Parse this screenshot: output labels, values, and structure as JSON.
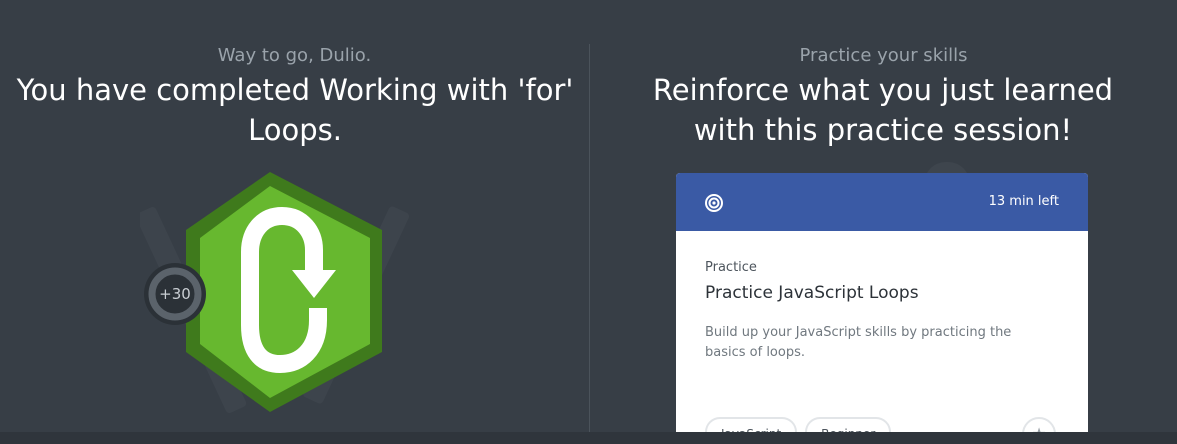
{
  "completion": {
    "eyebrow": "Way to go, Dulio.",
    "heading": "You have completed Working with 'for' Loops.",
    "xp": "+30",
    "badge_icon": "loop-arrow-icon"
  },
  "practice": {
    "eyebrow": "Practice your skills",
    "heading": "Reinforce what you just learned with this practice session!",
    "card": {
      "time_left": "13 min left",
      "type": "Practice",
      "title": "Practice JavaScript Loops",
      "description": "Build up your JavaScript skills by practicing the basics of loops.",
      "tags": [
        "JavaScript",
        "Beginner"
      ],
      "header_color": "#3a5aa5"
    }
  },
  "colors": {
    "background": "#373e46",
    "badge_green": "#67b82f",
    "badge_dark_green": "#3f7a1c"
  }
}
